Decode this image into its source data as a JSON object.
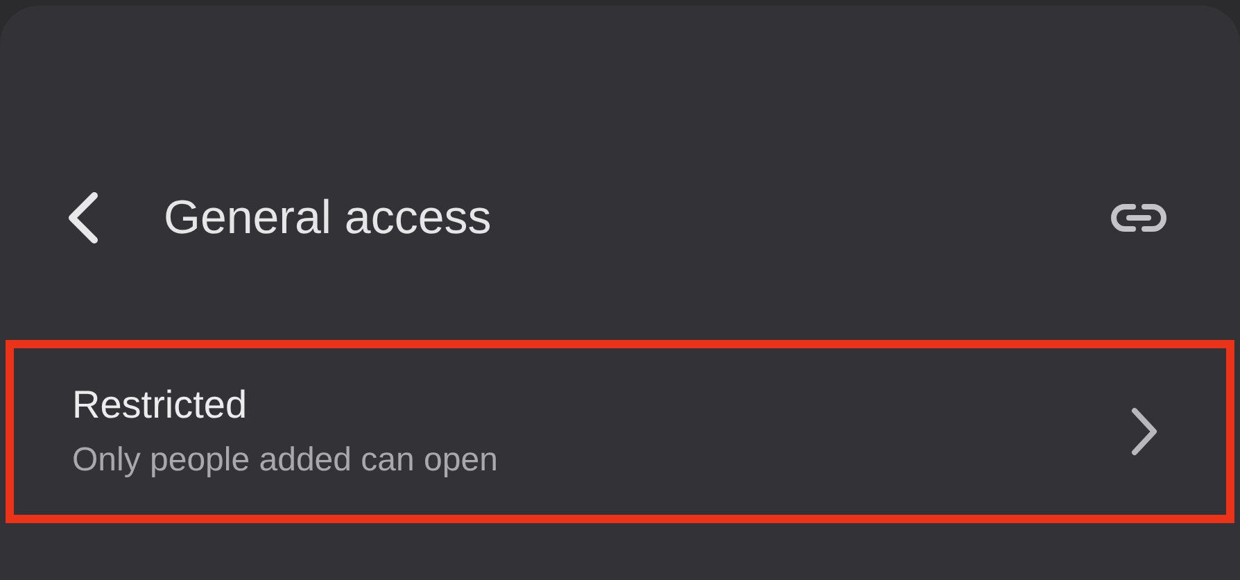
{
  "header": {
    "title": "General access"
  },
  "access_option": {
    "title": "Restricted",
    "description": "Only people added can open",
    "highlighted": true
  }
}
